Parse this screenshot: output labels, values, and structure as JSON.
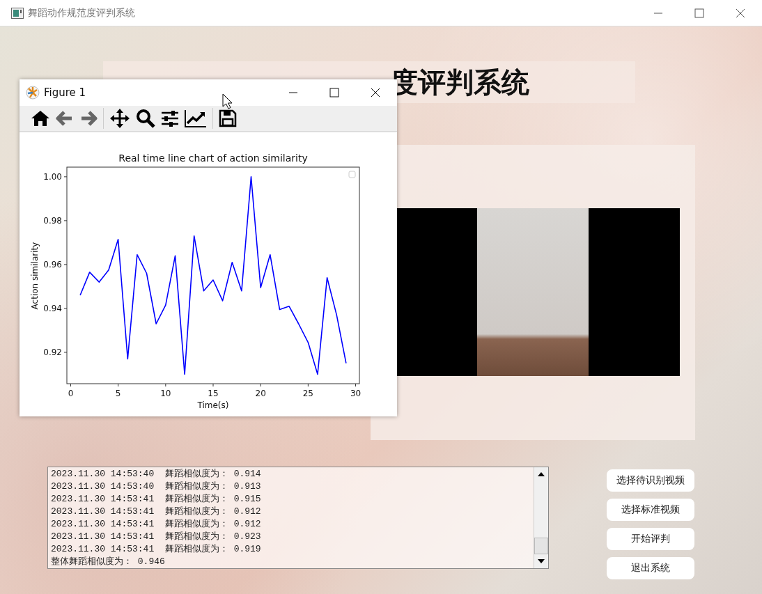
{
  "window": {
    "title": "舞蹈动作规范度评判系统"
  },
  "heading": "度评判系统",
  "figure_window": {
    "title": "Figure 1",
    "chart_data": {
      "type": "line",
      "title": "Real time line chart of action similarity",
      "xlabel": "Time(s)",
      "ylabel": "Action similarity",
      "x": [
        1,
        2,
        3,
        4,
        5,
        6,
        7,
        8,
        9,
        10,
        11,
        12,
        13,
        14,
        15,
        16,
        17,
        18,
        19,
        20,
        21,
        22,
        23,
        24,
        25,
        26,
        27,
        28,
        29
      ],
      "series": [
        {
          "color": "#0000ff",
          "values": [
            0.946,
            0.9565,
            0.952,
            0.9575,
            0.9715,
            0.917,
            0.9645,
            0.956,
            0.933,
            0.9415,
            0.964,
            0.91,
            0.973,
            0.948,
            0.953,
            0.9435,
            0.961,
            0.948,
            1.0,
            0.9495,
            0.9645,
            0.9395,
            0.941,
            0.933,
            0.9245,
            0.91,
            0.954,
            0.937,
            0.915
          ]
        }
      ],
      "xlim": [
        -0.4,
        30.4
      ],
      "ylim": [
        0.9057,
        1.0044
      ],
      "xticks": [
        0,
        5,
        10,
        15,
        20,
        25,
        30
      ],
      "yticks": [
        {
          "value": 0.92,
          "label": "0.92"
        },
        {
          "value": 0.94,
          "label": "0.94"
        },
        {
          "value": 0.96,
          "label": "0.96"
        },
        {
          "value": 0.98,
          "label": "0.98"
        },
        {
          "value": 1.0,
          "label": "1.00"
        }
      ]
    }
  },
  "log": {
    "lines": [
      "2023.11.30 14:53:40  舞蹈相似度为： 0.914",
      "2023.11.30 14:53:40  舞蹈相似度为： 0.913",
      "2023.11.30 14:53:41  舞蹈相似度为： 0.915",
      "2023.11.30 14:53:41  舞蹈相似度为： 0.912",
      "2023.11.30 14:53:41  舞蹈相似度为： 0.912",
      "2023.11.30 14:53:41  舞蹈相似度为： 0.923",
      "2023.11.30 14:53:41  舞蹈相似度为： 0.919"
    ],
    "summary": "整体舞蹈相似度为： 0.946"
  },
  "buttons": [
    "选择待识别视频",
    "选择标准视频",
    "开始评判",
    "退出系统"
  ]
}
